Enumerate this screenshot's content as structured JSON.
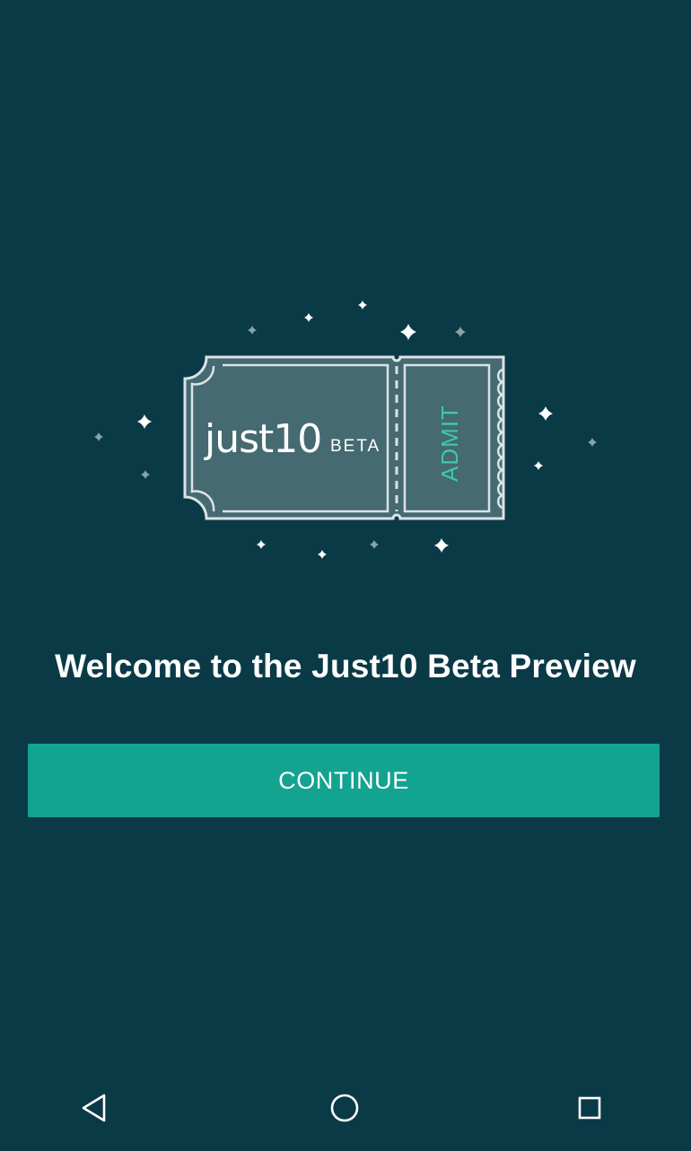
{
  "colors": {
    "background": "#0b3a47",
    "ticket_fill": "#456a71",
    "ticket_outline": "#dbe3e5",
    "accent": "#13a391",
    "admit_text": "#3fc7ad",
    "sparkle_bright": "#ffffff",
    "sparkle_dim": "#8aa3a9"
  },
  "hero": {
    "logo_text": "just10",
    "beta_badge": "BETA",
    "admit_label": "ADMIT",
    "sparkles_icon": "sparkle-icon"
  },
  "welcome": {
    "title": "Welcome to the Just10 Beta Preview"
  },
  "actions": {
    "continue_label": "CONTINUE"
  },
  "navbar": {
    "back_icon": "back-triangle-icon",
    "home_icon": "home-circle-icon",
    "recents_icon": "recents-square-icon"
  }
}
